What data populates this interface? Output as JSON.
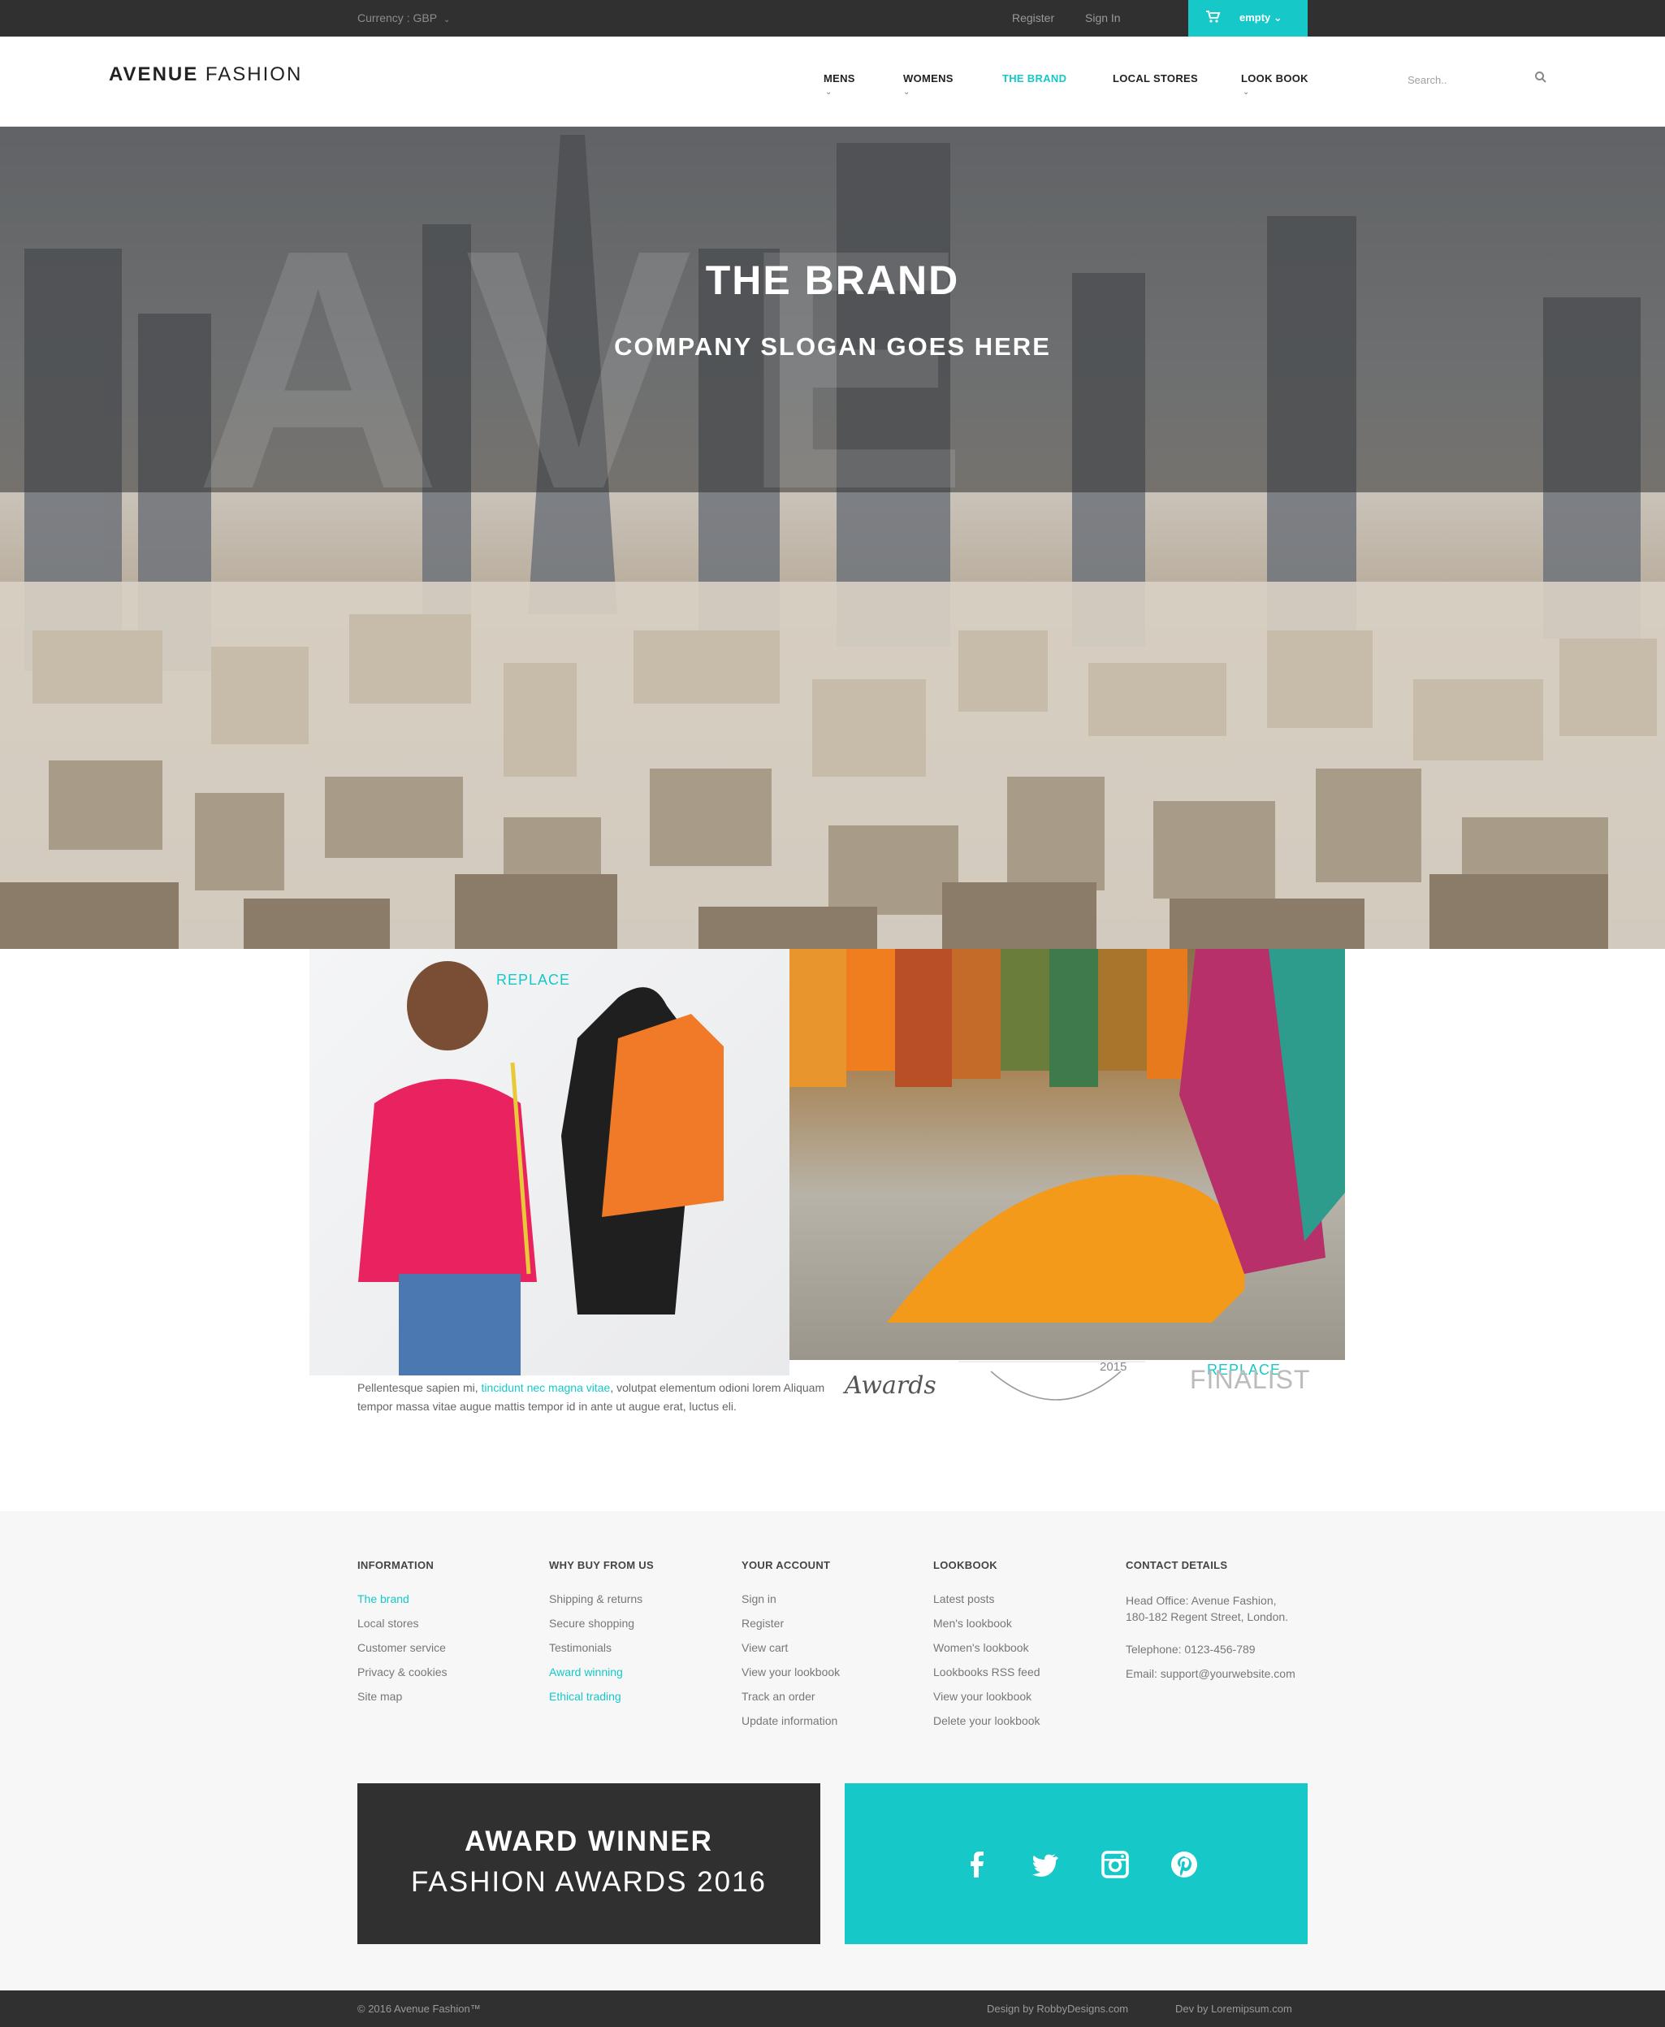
{
  "topbar": {
    "currency": "Currency : GBP",
    "register": "Register",
    "sign_in": "Sign In",
    "cart_label": "empty"
  },
  "header": {
    "logo_bold": "AVENUE",
    "logo_light": "FASHION",
    "nav": [
      "MENS",
      "WOMENS",
      "THE BRAND",
      "LOCAL STORES",
      "LOOK BOOK"
    ],
    "search_placeholder": "Search.."
  },
  "hero": {
    "title_bold": "THE",
    "title_light": "BRAND",
    "slogan": "COMPANY SLOGAN GOES HERE",
    "big_letters": "AVE"
  },
  "content": {
    "replace_1": "REPLACE",
    "replace_2": "REPLACE",
    "text_start": "Pellentesque sapien mi, ",
    "text_highlight": "tincidunt nec magna vitae",
    "text_end": ", volutpat elementum odioni lorem Aliquam tempor massa vitae augue mattis tempor id in ante ut augue erat, luctus eli.",
    "awards_script": "Awards",
    "year": "2015",
    "finalist": "FINALIST"
  },
  "footer": {
    "columns": [
      {
        "heading": "INFORMATION",
        "links": [
          "The brand",
          "Local stores",
          "Customer service",
          "Privacy & cookies",
          "Site map"
        ]
      },
      {
        "heading": "WHY BUY FROM US",
        "links": [
          "Shipping & returns",
          "Secure shopping",
          "Testimonials",
          "Award winning",
          "Ethical trading"
        ]
      },
      {
        "heading": "YOUR ACCOUNT",
        "links": [
          "Sign in",
          "Register",
          "View cart",
          "View your lookbook",
          "Track an order",
          "Update information"
        ]
      },
      {
        "heading": "LOOKBOOK",
        "links": [
          "Latest posts",
          "Men's lookbook",
          "Women's lookbook",
          "Lookbooks RSS feed",
          "View your lookbook",
          "Delete your lookbook"
        ]
      }
    ],
    "contact": {
      "heading": "CONTACT DETAILS",
      "office_line1": "Head Office: Avenue Fashion,",
      "office_line2": "180-182 Regent Street, London.",
      "telephone": "Telephone: 0123-456-789",
      "email": "Email: support@yourwebsite.com"
    },
    "award_line1": "AWARD WINNER",
    "award_line2": "FASHION AWARDS 2016",
    "social": [
      "facebook-icon",
      "twitter-icon",
      "instagram-icon",
      "pinterest-icon"
    ]
  },
  "bottombar": {
    "copyright": "© 2016 Avenue Fashion™",
    "design_credit": "Design by RobbyDesigns.com",
    "dev_credit": "Dev by Loremipsum.com"
  },
  "colors": {
    "accent": "#16c8c8",
    "dark": "#303030"
  }
}
